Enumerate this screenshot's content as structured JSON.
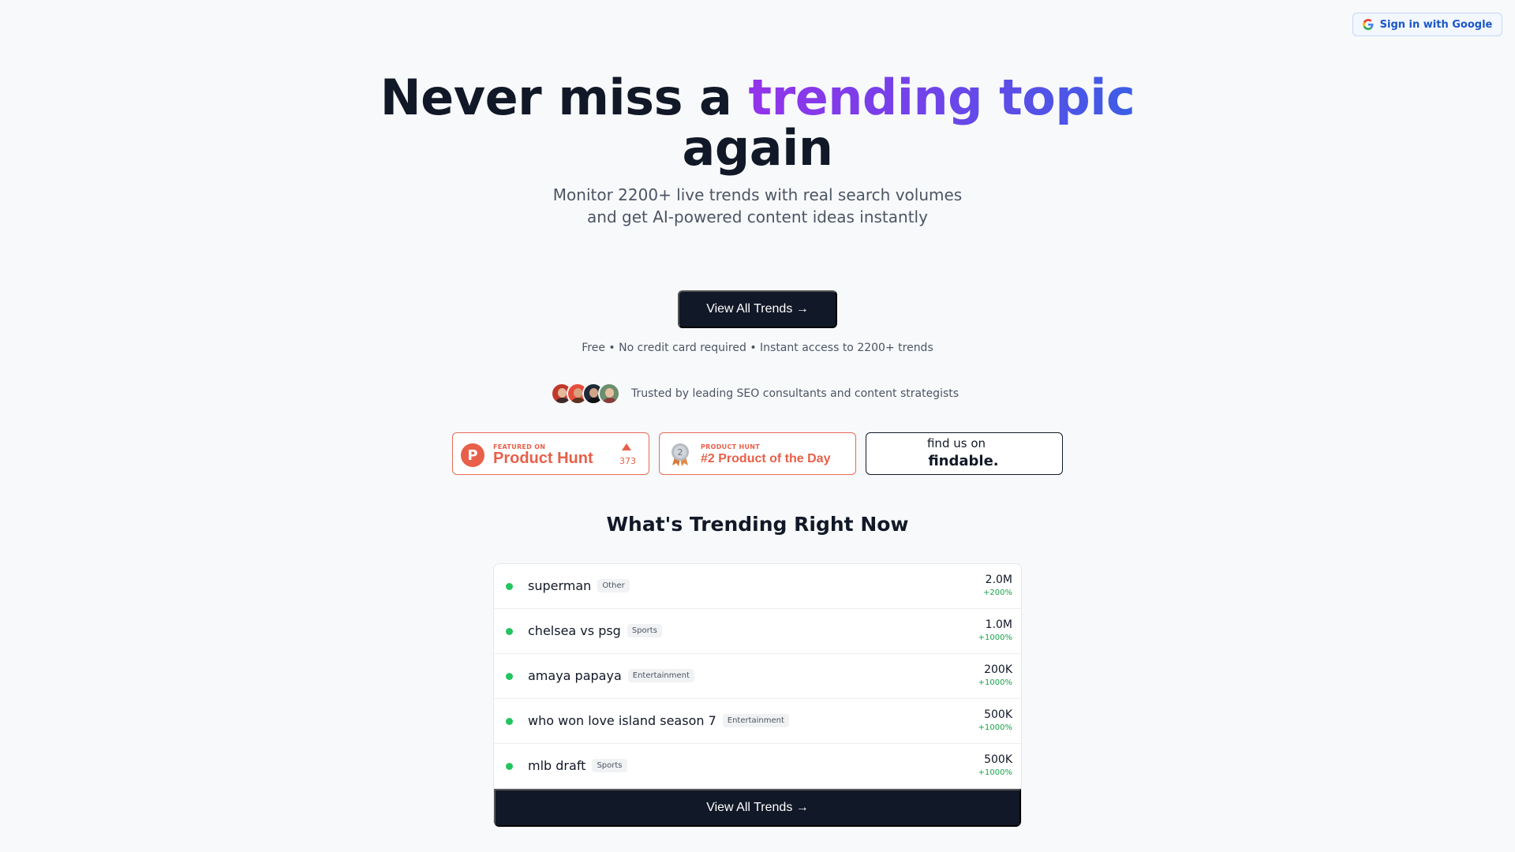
{
  "header": {
    "signin_label": "Sign in with Google",
    "signin_icon": "google-g-icon"
  },
  "hero": {
    "title_lead": "Never miss a ",
    "title_accent": "trending topic",
    "title_tail": "again",
    "subtitle_line1": "Monitor 2200+ live trends with real search volumes",
    "subtitle_line2": "and get AI-powered content ideas instantly",
    "cta_label": "View All Trends →",
    "note": "Free • No credit card required • Instant access to 2200+ trends",
    "trust_text": "Trusted by leading SEO consultants and content strategists",
    "accent_colors": [
      "#9333ea",
      "#3b5ee6"
    ]
  },
  "badges": {
    "product_hunt": {
      "small": "FEATURED ON",
      "big": "Product Hunt",
      "count": "373"
    },
    "product_of_day": {
      "small": "PRODUCT HUNT",
      "big": "#2 Product of the Day",
      "medal_number": "2"
    },
    "findable": {
      "small": "find us on",
      "big": "findable."
    }
  },
  "trending": {
    "title": "What's Trending Right Now",
    "items": [
      {
        "term": "superman",
        "category": "Other",
        "volume": "2.0M",
        "change": "+200%"
      },
      {
        "term": "chelsea vs psg",
        "category": "Sports",
        "volume": "1.0M",
        "change": "+1000%"
      },
      {
        "term": "amaya papaya",
        "category": "Entertainment",
        "volume": "200K",
        "change": "+1000%"
      },
      {
        "term": "who won love island season 7",
        "category": "Entertainment",
        "volume": "500K",
        "change": "+1000%"
      },
      {
        "term": "mlb draft",
        "category": "Sports",
        "volume": "500K",
        "change": "+1000%"
      }
    ],
    "cta_label": "View All Trends →"
  }
}
